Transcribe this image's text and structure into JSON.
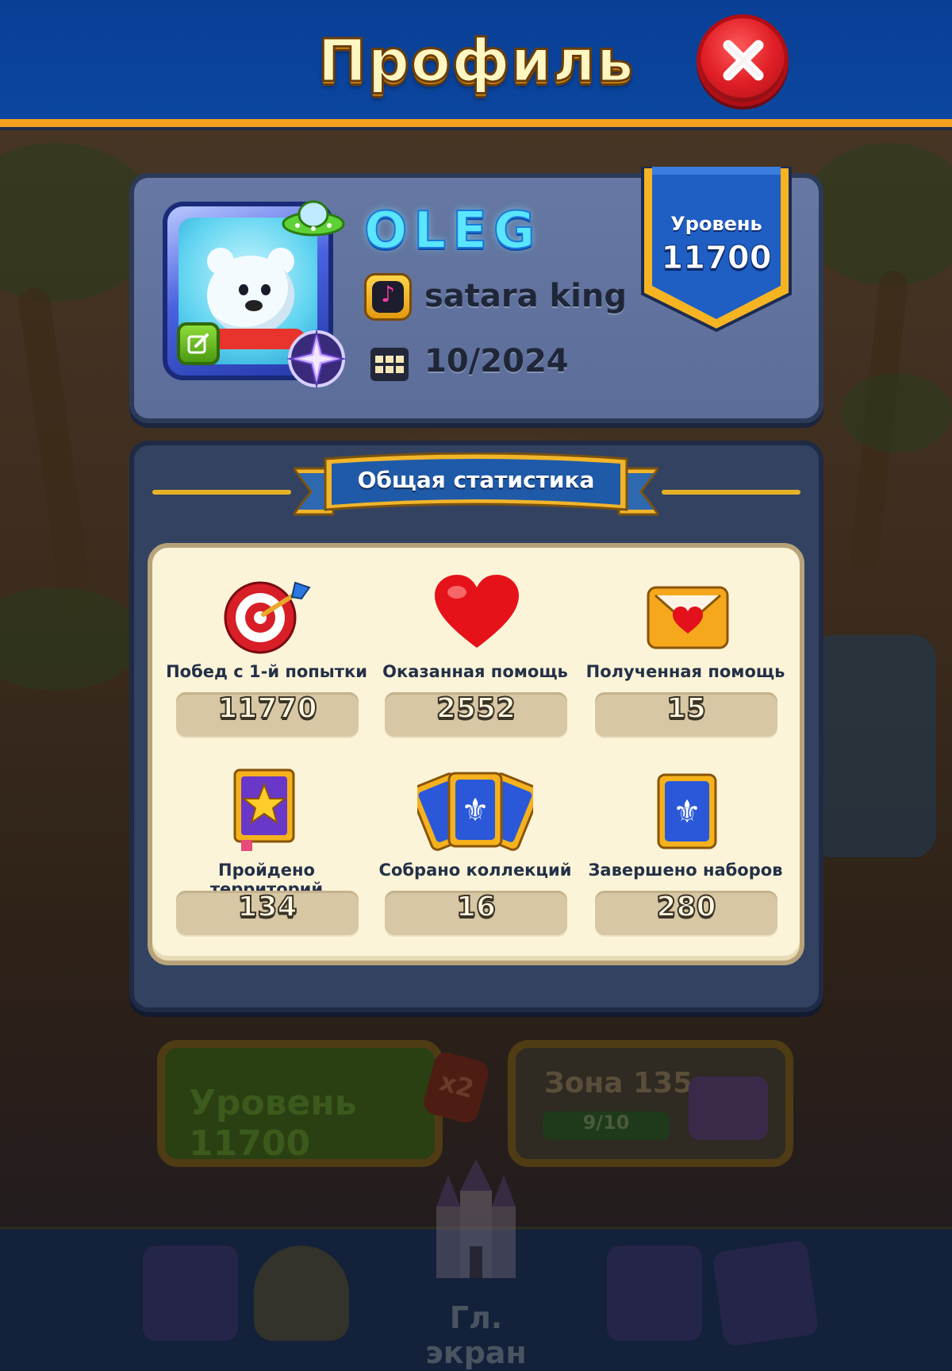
{
  "header": {
    "title": "Профиль",
    "close_icon": "close-icon"
  },
  "profile": {
    "player_name": "OLEG",
    "team_name": "satara king",
    "team_icon": "music-note-icon",
    "join_date": "10/2024",
    "calendar_icon": "calendar-icon",
    "edit_icon": "edit-icon",
    "level_label": "Уровень",
    "level_value": "11700"
  },
  "stats": {
    "title": "Общая статистика",
    "items": [
      {
        "label": "Побед с 1-й попытки",
        "value": "11770",
        "icon": "target-icon"
      },
      {
        "label": "Оказанная помощь",
        "value": "2552",
        "icon": "heart-icon"
      },
      {
        "label": "Полученная помощь",
        "value": "15",
        "icon": "envelope-heart-icon"
      },
      {
        "label": "Пройдено территорий",
        "value": "134",
        "icon": "star-book-icon"
      },
      {
        "label": "Собрано коллекций",
        "value": "16",
        "icon": "card-fan-icon"
      },
      {
        "label": "Завершено наборов",
        "value": "280",
        "icon": "card-icon"
      }
    ]
  },
  "background": {
    "level_button_label": "Уровень 11700",
    "multiplier_label": "x2",
    "zone_label": "Зона 135",
    "zone_progress": "9/10",
    "home_label": "Гл. экран"
  },
  "colors": {
    "header_blue": "#0b469f",
    "accent_gold": "#f4a01e",
    "close_red": "#e01e26",
    "stats_card": "#fbf4d8",
    "value_box": "#d8c7a4"
  }
}
